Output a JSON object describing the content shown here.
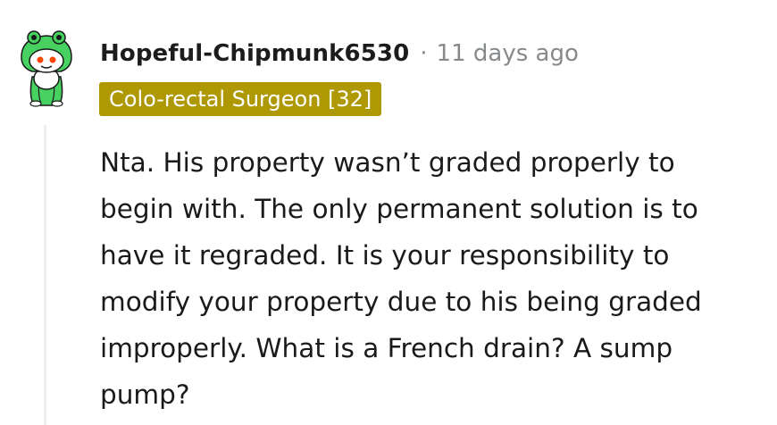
{
  "comment": {
    "author": "Hopeful-Chipmunk6530",
    "separator": "·",
    "timestamp": "11 days ago",
    "flair": "Colo-rectal Surgeon [32]",
    "body": "Nta. His property wasn’t graded properly to begin with. The only permanent solution is to have it regraded. It is your responsibility to modify your property due to his being graded improperly. What is a French drain? A sump pump?"
  },
  "colors": {
    "flair_background": "#ae9803",
    "flair_text": "#ffffff",
    "meta_text": "#878a8c",
    "thread_line": "#edeff1",
    "avatar_green": "#46d160",
    "snoo_eye": "#ff4500"
  },
  "icons": {
    "avatar": "snoo-frog-hood-avatar-icon"
  }
}
